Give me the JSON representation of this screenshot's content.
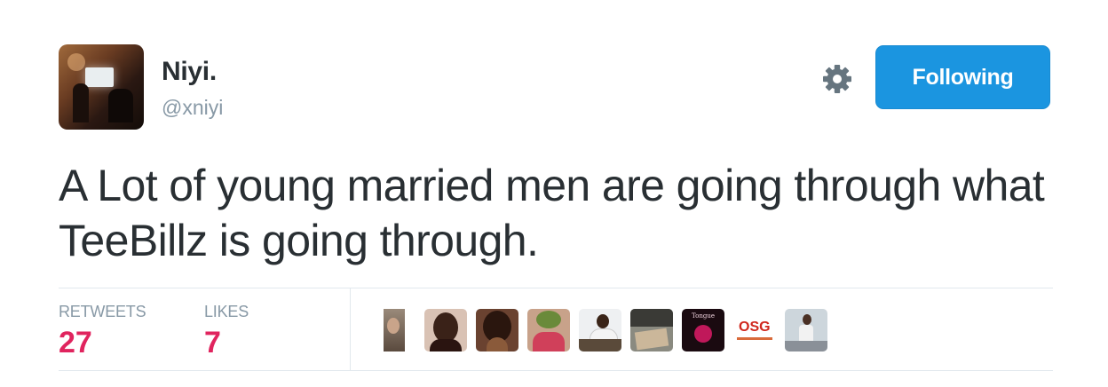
{
  "author": {
    "name": "Niyi.",
    "handle": "@xniyi"
  },
  "follow_button": {
    "label": "Following"
  },
  "settings_icon": "gear-icon",
  "tweet": {
    "text": "A Lot of young married men are going through what TeeBillz is going through."
  },
  "stats": {
    "retweets_label": "RETWEETS",
    "retweets_value": "27",
    "likes_label": "LIKES",
    "likes_value": "7"
  },
  "likers": [
    {
      "id": "liker-1"
    },
    {
      "id": "liker-2"
    },
    {
      "id": "liker-3"
    },
    {
      "id": "liker-4"
    },
    {
      "id": "liker-5"
    },
    {
      "id": "liker-6"
    },
    {
      "id": "liker-7",
      "text": "Tongue"
    },
    {
      "id": "liker-8",
      "text": "OSG"
    },
    {
      "id": "liker-9"
    }
  ],
  "colors": {
    "accent": "#1b95e0",
    "stat_value": "#e0245e",
    "muted": "#8899a6",
    "text": "#292f33"
  }
}
